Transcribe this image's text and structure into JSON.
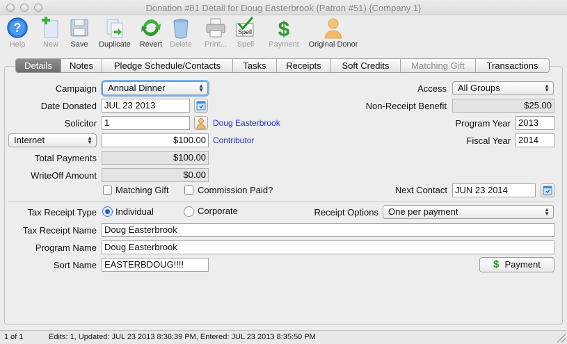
{
  "window": {
    "title": "Donation #81 Detail for Doug Easterbrook (Patron #51) {Company 1}"
  },
  "toolbar": {
    "help": "Help",
    "new": "New",
    "save": "Save",
    "duplicate": "Duplicate",
    "revert": "Revert",
    "delete": "Delete",
    "print": "Print...",
    "spell": "Spell",
    "payment": "Payment",
    "original_donor": "Original Donor",
    "spell_icon_text": "Spell",
    "payment_icon_text": "$"
  },
  "tabs": [
    {
      "label": "Details",
      "state": "active"
    },
    {
      "label": "Notes",
      "state": "normal"
    },
    {
      "label": "Pledge Schedule/Contacts",
      "state": "normal"
    },
    {
      "label": "Tasks",
      "state": "normal"
    },
    {
      "label": "Receipts",
      "state": "normal"
    },
    {
      "label": "Soft Credits",
      "state": "normal"
    },
    {
      "label": "Matching Gift",
      "state": "disabled"
    },
    {
      "label": "Transactions",
      "state": "normal"
    }
  ],
  "form": {
    "campaign_label": "Campaign",
    "campaign_value": "Annual Dinner",
    "date_donated_label": "Date Donated",
    "date_donated_value": "JUL 23 2013",
    "solicitor_label": "Solicitor",
    "solicitor_value": "1",
    "solicitor_name": "Doug Easterbrook",
    "method_value": "Internet",
    "amount_value": "$100.00",
    "contributor_link": "Contributor",
    "total_payments_label": "Total Payments",
    "total_payments_value": "$100.00",
    "writeoff_label": "WriteOff Amount",
    "writeoff_value": "$0.00",
    "matching_gift_label": "Matching Gift",
    "commission_paid_label": "Commission Paid?",
    "access_label": "Access",
    "access_value": "All Groups",
    "non_receipt_label": "Non-Receipt Benefit",
    "non_receipt_value": "$25.00",
    "program_year_label": "Program Year",
    "program_year_value": "2013",
    "fiscal_year_label": "Fiscal Year",
    "fiscal_year_value": "2014",
    "next_contact_label": "Next Contact",
    "next_contact_value": "JUN 23 2014",
    "tax_receipt_type_label": "Tax Receipt Type",
    "individual_label": "Individual",
    "corporate_label": "Corporate",
    "receipt_options_label": "Receipt Options",
    "receipt_options_value": "One per payment",
    "tax_receipt_name_label": "Tax Receipt Name",
    "tax_receipt_name_value": "Doug Easterbrook",
    "program_name_label": "Program Name",
    "program_name_value": "Doug Easterbrook",
    "sort_name_label": "Sort Name",
    "sort_name_value": "EASTERBDOUG!!!!",
    "payment_button": "Payment",
    "payment_button_icon": "$"
  },
  "status": {
    "record_count": "1 of 1",
    "info": "Edits: 1, Updated: JUL 23 2013 8:36:39 PM, Entered: JUL 23 2013 8:35:50 PM"
  },
  "colors": {
    "link": "#1f2fd1",
    "accent": "#3b74d8",
    "money_green": "#2f9a2f"
  }
}
